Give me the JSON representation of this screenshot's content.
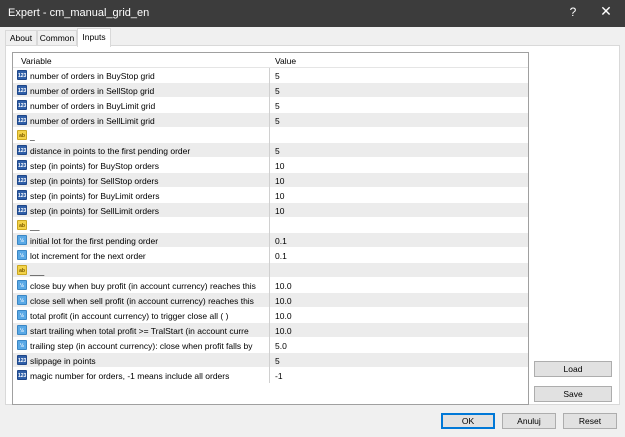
{
  "window": {
    "title": "Expert - cm_manual_grid_en",
    "help_glyph": "?",
    "close_glyph": "✕"
  },
  "tabs": [
    "About",
    "Common",
    "Inputs"
  ],
  "table": {
    "headers": {
      "variable": "Variable",
      "value": "Value"
    },
    "rows": [
      {
        "type": "int",
        "icon": "123",
        "variable": "number of orders in BuyStop grid",
        "value": "5"
      },
      {
        "type": "int",
        "icon": "123",
        "variable": "number of orders in SellStop grid",
        "value": "5"
      },
      {
        "type": "int",
        "icon": "123",
        "variable": "number of orders in BuyLimit grid",
        "value": "5"
      },
      {
        "type": "int",
        "icon": "123",
        "variable": "number of orders in SellLimit grid",
        "value": "5"
      },
      {
        "type": "str",
        "icon": "ab",
        "variable": "_",
        "value": ""
      },
      {
        "type": "int",
        "icon": "123",
        "variable": "distance in points to the first pending order",
        "value": "5"
      },
      {
        "type": "int",
        "icon": "123",
        "variable": "step (in points) for BuyStop orders",
        "value": "10"
      },
      {
        "type": "int",
        "icon": "123",
        "variable": "step (in points) for SellStop orders",
        "value": "10"
      },
      {
        "type": "int",
        "icon": "123",
        "variable": "step (in points) for BuyLimit orders",
        "value": "10"
      },
      {
        "type": "int",
        "icon": "123",
        "variable": "step (in points) for SellLimit orders",
        "value": "10"
      },
      {
        "type": "str",
        "icon": "ab",
        "variable": "__",
        "value": ""
      },
      {
        "type": "dbl",
        "icon": "½",
        "variable": "initial lot for the first pending order",
        "value": "0.1"
      },
      {
        "type": "dbl",
        "icon": "½",
        "variable": "lot increment for the next order",
        "value": "0.1"
      },
      {
        "type": "str",
        "icon": "ab",
        "variable": "___",
        "value": ""
      },
      {
        "type": "dbl",
        "icon": "½",
        "variable": "close buy when buy profit (in account currency) reaches this",
        "value": "10.0"
      },
      {
        "type": "dbl",
        "icon": "½",
        "variable": "close sell when sell profit (in account currency) reaches this",
        "value": "10.0"
      },
      {
        "type": "dbl",
        "icon": "½",
        "variable": "total profit (in account currency) to trigger close all ( )",
        "value": "10.0"
      },
      {
        "type": "dbl",
        "icon": "½",
        "variable": "start trailing when total profit >= TralStart (in account curre",
        "value": "10.0"
      },
      {
        "type": "dbl",
        "icon": "½",
        "variable": "trailing step (in account currency): close when profit falls by",
        "value": "5.0"
      },
      {
        "type": "int",
        "icon": "123",
        "variable": "slippage in points",
        "value": "5"
      },
      {
        "type": "int",
        "icon": "123",
        "variable": "magic number for orders, -1 means include all orders",
        "value": "-1"
      }
    ]
  },
  "side_buttons": {
    "load": "Load",
    "save": "Save"
  },
  "footer_buttons": {
    "ok": "OK",
    "cancel": "Anuluj",
    "reset": "Reset"
  }
}
